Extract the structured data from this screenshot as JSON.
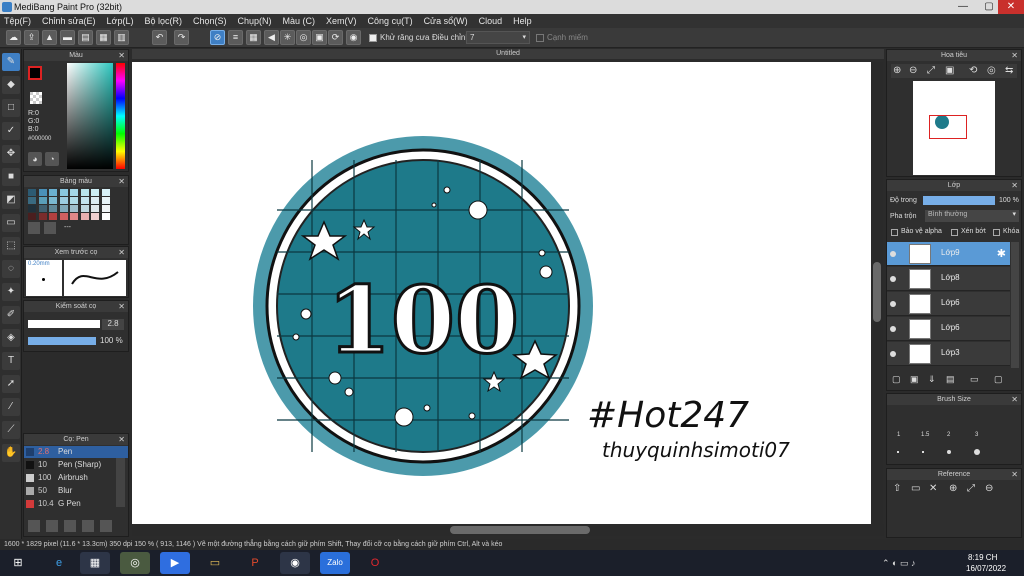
{
  "window": {
    "title": "MediBang Paint Pro (32bit)",
    "min": "—",
    "max": "▢",
    "close": "✕"
  },
  "menu": [
    "Tệp(F)",
    "Chỉnh sửa(E)",
    "Lớp(L)",
    "Bộ lọc(R)",
    "Chọn(S)",
    "Chụp(N)",
    "Màu (C)",
    "Xem(V)",
    "Công cụ(T)",
    "Cửa sổ(W)",
    "Cloud",
    "Help"
  ],
  "toolbar": {
    "antialias_label": "Khử răng cưa",
    "correction_label": "Điều chỉnh",
    "correction_value": "7",
    "edge_label": "Cạnh miếm"
  },
  "color_panel": {
    "title": "Màu",
    "r": "R:0",
    "g": "G:0",
    "b": "B:0",
    "hex": "#000000",
    "fg": "#000000",
    "bg": "#ffffff"
  },
  "palette_panel": {
    "title": "Bảng màu",
    "add": "---"
  },
  "preview_panel": {
    "title": "Xem trước cọ",
    "size": "0.20mm"
  },
  "control_panel": {
    "title": "Kiểm soát cọ",
    "size": "2.8",
    "opacity": "100 %"
  },
  "brush_panel": {
    "title": "Cọ: Pen",
    "items": [
      {
        "size": "2.8",
        "name": "Pen",
        "color": "#1e3f6e",
        "selected": true
      },
      {
        "size": "10",
        "name": "Pen (Sharp)",
        "color": "#111111"
      },
      {
        "size": "100",
        "name": "Airbrush",
        "color": "#cccccc"
      },
      {
        "size": "50",
        "name": "Blur",
        "color": "#aaaaaa"
      },
      {
        "size": "10.4",
        "name": "G Pen",
        "color": "#d23a3a"
      }
    ]
  },
  "canvas": {
    "title": "Untitled",
    "badge_number": "100",
    "sig_line1": "#Hot247",
    "sig_line2": "thuyquinhsimoti07",
    "badge_color": "#1e7a8a",
    "ring_color": "#4c9aab"
  },
  "navigator": {
    "title": "Hoa tiêu"
  },
  "layers_panel": {
    "title": "Lớp",
    "opacity_label": "Độ trong",
    "opacity_value": "100 %",
    "blend_label": "Pha trộn",
    "blend_value": "Bình thường",
    "protect_alpha": "Bảo vệ alpha",
    "clip": "Xén bớt",
    "lock": "Khóa",
    "layers": [
      "Lớp9",
      "Lớp8",
      "Lớp6",
      "Lớp6",
      "Lớp3"
    ]
  },
  "brush_size_panel": {
    "title": "Brush Size",
    "labels": [
      "1",
      "1.5",
      "2",
      "3"
    ]
  },
  "reference_panel": {
    "title": "Reference"
  },
  "status": {
    "text": "1600 * 1829 pixel   (11.6 * 13.3cm)   350 dpi   150 %   ( 913, 1146 )   Vẽ một đường thẳng bằng cách giữ phím Shift, Thay đổi cỡ cọ bằng cách giữ phím Ctrl, Alt và kéo"
  },
  "taskbar": {
    "time": "8:19 CH",
    "date": "16/07/2022",
    "zalo": "Zalo"
  }
}
